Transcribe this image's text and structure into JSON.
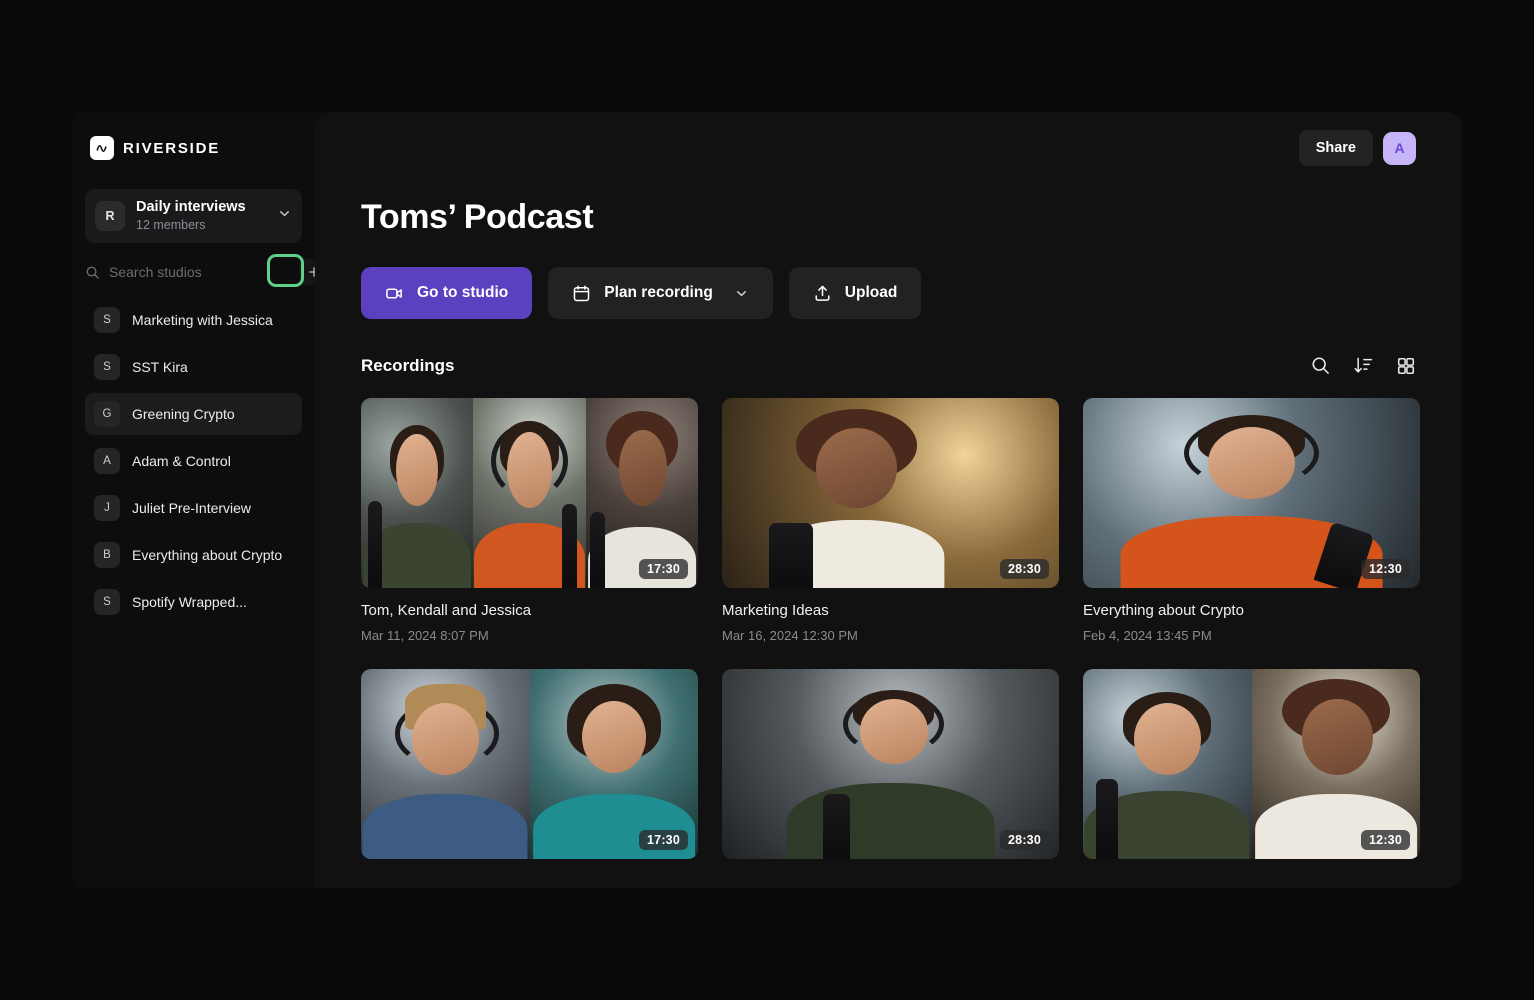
{
  "brand": {
    "name": "RIVERSIDE",
    "logo_icon": "waveform-icon"
  },
  "sidebar": {
    "org": {
      "avatar_initial": "R",
      "name": "Daily interviews",
      "members": "12 members",
      "chevron_icon": "chevron-down-icon"
    },
    "search": {
      "placeholder": "Search studios",
      "value": "",
      "icon": "search-icon"
    },
    "add_button": {
      "icon": "plus-icon",
      "highlighted": true,
      "highlight_color": "#5fd08a"
    },
    "studios": [
      {
        "badge": "S",
        "label": "Marketing with Jessica",
        "active": false
      },
      {
        "badge": "S",
        "label": "SST Kira",
        "active": false
      },
      {
        "badge": "G",
        "label": "Greening Crypto",
        "active": true
      },
      {
        "badge": "A",
        "label": "Adam & Control",
        "active": false
      },
      {
        "badge": "J",
        "label": "Juliet Pre-Interview",
        "active": false
      },
      {
        "badge": "B",
        "label": "Everything about Crypto",
        "active": false
      },
      {
        "badge": "S",
        "label": "Spotify Wrapped...",
        "active": false
      }
    ]
  },
  "topbar": {
    "share_label": "Share",
    "avatar_initial": "A",
    "avatar_color": "#c6b5f7"
  },
  "main": {
    "title": "Toms’ Podcast",
    "actions": [
      {
        "label": "Go to studio",
        "icon": "video-camera-icon",
        "style": "primary",
        "accent": "#5b40c0"
      },
      {
        "label": "Plan recording",
        "icon": "calendar-icon",
        "style": "secondary",
        "chevron_icon": "chevron-down-icon"
      },
      {
        "label": "Upload",
        "icon": "upload-icon",
        "style": "secondary"
      }
    ],
    "section": {
      "title": "Recordings",
      "tools": [
        {
          "name": "search-icon"
        },
        {
          "name": "sort-descending-icon"
        },
        {
          "name": "grid-view-icon"
        }
      ]
    },
    "recordings": [
      {
        "title": "Tom, Kendall and Jessica",
        "date": "Mar 11, 2024 8:07 PM",
        "duration": "17:30",
        "panes": 3,
        "scene": "three-guests"
      },
      {
        "title": "Marketing Ideas",
        "date": "Mar 16, 2024 12:30 PM",
        "duration": "28:30",
        "panes": 1,
        "scene": "single-warm"
      },
      {
        "title": "Everything about Crypto",
        "date": "Feb 4, 2024 13:45 PM",
        "duration": "12:30",
        "panes": 1,
        "scene": "single-window"
      },
      {
        "title": "",
        "date": "",
        "duration": "17:30",
        "panes": 2,
        "scene": "two-guests"
      },
      {
        "title": "",
        "date": "",
        "duration": "28:30",
        "panes": 1,
        "scene": "single-office"
      },
      {
        "title": "",
        "date": "",
        "duration": "12:30",
        "panes": 2,
        "scene": "two-joy"
      }
    ]
  }
}
